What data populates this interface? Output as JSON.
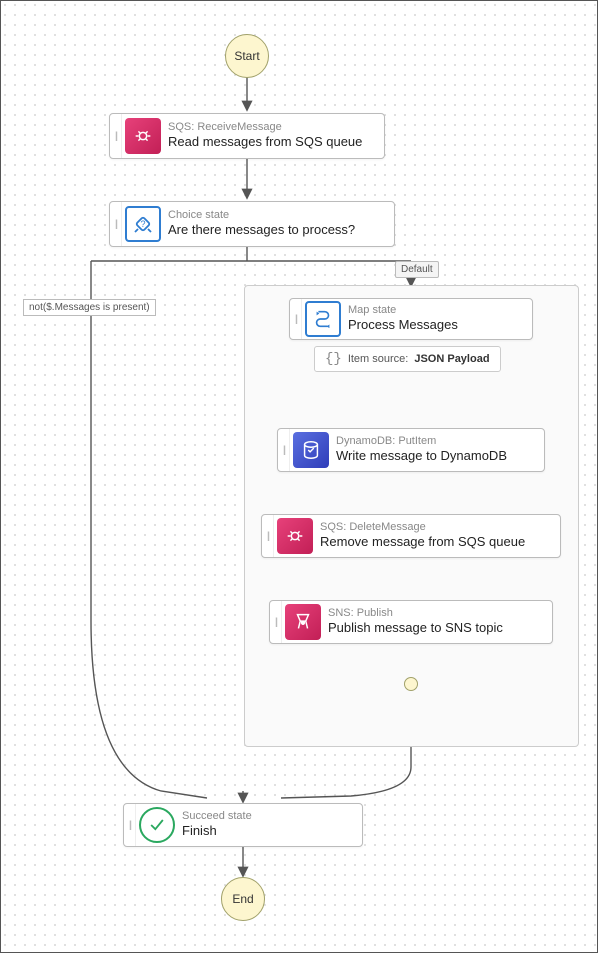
{
  "terminals": {
    "start": "Start",
    "end": "End"
  },
  "nodes": {
    "receive": {
      "subtitle": "SQS: ReceiveMessage",
      "title": "Read messages from SQS queue"
    },
    "choice": {
      "subtitle": "Choice state",
      "title": "Are there messages to process?"
    },
    "map": {
      "subtitle": "Map state",
      "title": "Process Messages"
    },
    "putitem": {
      "subtitle": "DynamoDB: PutItem",
      "title": "Write message to DynamoDB"
    },
    "delete": {
      "subtitle": "SQS: DeleteMessage",
      "title": "Remove message from SQS queue"
    },
    "publish": {
      "subtitle": "SNS: Publish",
      "title": "Publish message to SNS topic"
    },
    "succeed": {
      "subtitle": "Succeed state",
      "title": "Finish"
    }
  },
  "branches": {
    "default": "Default",
    "not_present": "not($.Messages is present)"
  },
  "item_source": {
    "label": "Item source:",
    "value": "JSON Payload"
  },
  "chart_data": {
    "type": "state-machine",
    "title": "",
    "start": "Start",
    "end": "End",
    "states": [
      {
        "id": "Start",
        "type": "start"
      },
      {
        "id": "ReceiveMessage",
        "type": "task",
        "service": "SQS: ReceiveMessage",
        "label": "Read messages from SQS queue"
      },
      {
        "id": "Choice",
        "type": "choice",
        "label": "Are there messages to process?",
        "subtitle": "Choice state"
      },
      {
        "id": "ProcessMessages",
        "type": "map",
        "label": "Process Messages",
        "subtitle": "Map state",
        "item_source": "JSON Payload",
        "iterator": [
          "PutItem",
          "DeleteMessage",
          "Publish"
        ]
      },
      {
        "id": "PutItem",
        "type": "task",
        "service": "DynamoDB: PutItem",
        "label": "Write message to DynamoDB"
      },
      {
        "id": "DeleteMessage",
        "type": "task",
        "service": "SQS: DeleteMessage",
        "label": "Remove message from SQS queue"
      },
      {
        "id": "Publish",
        "type": "task",
        "service": "SNS: Publish",
        "label": "Publish message to SNS topic"
      },
      {
        "id": "Finish",
        "type": "succeed",
        "label": "Finish",
        "subtitle": "Succeed state"
      },
      {
        "id": "End",
        "type": "end"
      }
    ],
    "transitions": [
      {
        "from": "Start",
        "to": "ReceiveMessage"
      },
      {
        "from": "ReceiveMessage",
        "to": "Choice"
      },
      {
        "from": "Choice",
        "to": "Finish",
        "condition": "not($.Messages is present)"
      },
      {
        "from": "Choice",
        "to": "ProcessMessages",
        "condition": "Default"
      },
      {
        "from": "PutItem",
        "to": "DeleteMessage"
      },
      {
        "from": "DeleteMessage",
        "to": "Publish"
      },
      {
        "from": "ProcessMessages",
        "to": "Finish"
      },
      {
        "from": "Finish",
        "to": "End"
      }
    ]
  }
}
